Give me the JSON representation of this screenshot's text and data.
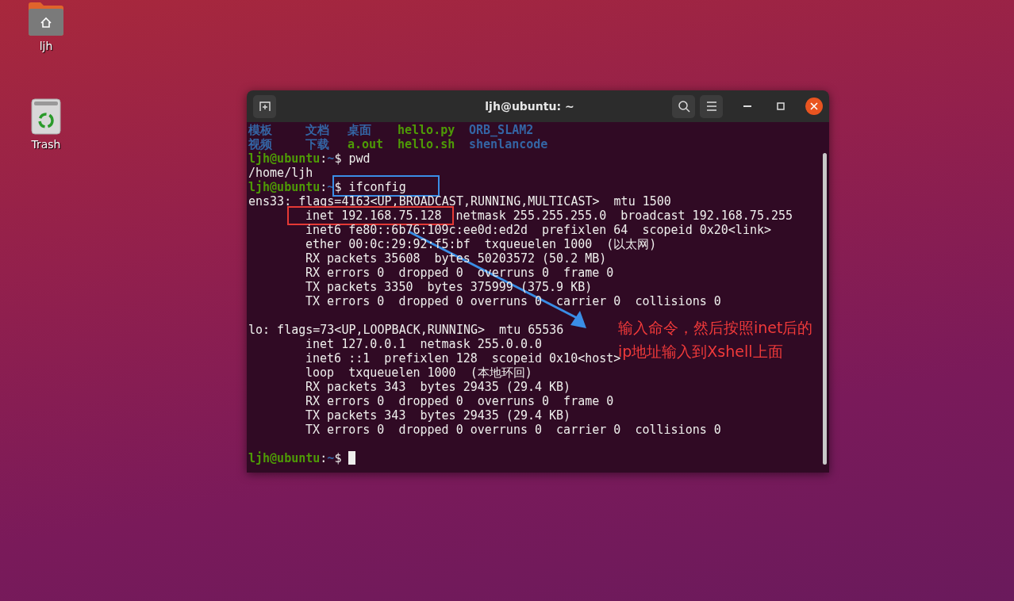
{
  "desktop_icons": [
    {
      "label": "ljh",
      "kind": "home"
    },
    {
      "label": "Trash",
      "kind": "trash"
    }
  ],
  "window": {
    "title": "ljh@ubuntu: ~"
  },
  "terminal": {
    "cursor": true,
    "lines": [
      {
        "kind": "listing",
        "items": [
          {
            "text": "模板",
            "kind": "dir"
          },
          {
            "text": "文档",
            "kind": "dir"
          },
          {
            "text": "桌面",
            "kind": "dir"
          },
          {
            "text": "hello.py",
            "kind": "exec"
          },
          {
            "text": "ORB_SLAM2",
            "kind": "dir"
          }
        ]
      },
      {
        "kind": "listing",
        "items": [
          {
            "text": "视频",
            "kind": "dir"
          },
          {
            "text": "下载",
            "kind": "dir"
          },
          {
            "text": "a.out",
            "kind": "exec"
          },
          {
            "text": "hello.sh",
            "kind": "exec"
          },
          {
            "text": "shenlancode",
            "kind": "dir"
          }
        ]
      },
      {
        "kind": "text",
        "segments": [
          {
            "text": "ljh@ubuntu",
            "kind": "user"
          },
          {
            "text": ":",
            "kind": "plain"
          },
          {
            "text": "~",
            "kind": "path"
          },
          {
            "text": "$ pwd",
            "kind": "plain"
          }
        ]
      },
      {
        "kind": "text",
        "segments": [
          {
            "text": "/home/ljh",
            "kind": "plain"
          }
        ]
      },
      {
        "kind": "text",
        "segments": [
          {
            "text": "ljh@ubuntu",
            "kind": "user"
          },
          {
            "text": ":",
            "kind": "plain"
          },
          {
            "text": "~",
            "kind": "path"
          },
          {
            "text": "$ ifconfig",
            "kind": "plain",
            "color": "#3a8ee6"
          }
        ]
      },
      {
        "kind": "text",
        "segments": [
          {
            "text": "ens33: flags=4163<UP,BROADCAST,RUNNING,MULTICAST>  mtu 1500",
            "kind": "plain"
          }
        ]
      },
      {
        "kind": "detail",
        "segments": [
          {
            "text": "inet 192.168.75.128",
            "kind": "plain",
            "color": "#e53935"
          },
          {
            "text": "netmask 255.255.255.0  broadcast 192.168.75.255",
            "kind": "plain"
          }
        ]
      },
      {
        "kind": "detail",
        "segments": [
          {
            "text": "inet6 fe80::6b76:109c:ee0d:ed2d  prefixlen 64  scopeid 0x20<link>",
            "kind": "plain"
          }
        ]
      },
      {
        "kind": "detail",
        "segments": [
          {
            "text": "ether 00:0c:29:92:f5:bf  txqueuelen 1000  (以太网)",
            "kind": "plain"
          }
        ]
      },
      {
        "kind": "detail",
        "segments": [
          {
            "text": "RX packets 35608  bytes 50203572 (50.2 MB)",
            "kind": "plain"
          }
        ]
      },
      {
        "kind": "detail",
        "segments": [
          {
            "text": "RX errors 0  dropped 0  overruns 0  frame 0",
            "kind": "plain"
          }
        ]
      },
      {
        "kind": "detail",
        "segments": [
          {
            "text": "TX packets 3350  bytes 375999 (375.9 KB)",
            "kind": "plain"
          }
        ]
      },
      {
        "kind": "detail",
        "segments": [
          {
            "text": "TX errors 0  dropped 0 overruns 0  carrier 0  collisions 0",
            "kind": "plain"
          }
        ]
      },
      {
        "kind": "blank"
      },
      {
        "kind": "text",
        "segments": [
          {
            "text": "lo: flags=73<UP,LOOPBACK,RUNNING>  mtu 65536",
            "kind": "plain"
          }
        ]
      },
      {
        "kind": "detail",
        "segments": [
          {
            "text": "inet 127.0.0.1  netmask 255.0.0.0",
            "kind": "plain"
          }
        ]
      },
      {
        "kind": "detail",
        "segments": [
          {
            "text": "inet6 ::1  prefixlen 128  scopeid 0x10<host>",
            "kind": "plain"
          }
        ]
      },
      {
        "kind": "detail",
        "segments": [
          {
            "text": "loop  txqueuelen 1000  (本地环回)",
            "kind": "plain"
          }
        ]
      },
      {
        "kind": "detail",
        "segments": [
          {
            "text": "RX packets 343  bytes 29435 (29.4 KB)",
            "kind": "plain"
          }
        ]
      },
      {
        "kind": "detail",
        "segments": [
          {
            "text": "RX errors 0  dropped 0  overruns 0  frame 0",
            "kind": "plain"
          }
        ]
      },
      {
        "kind": "detail",
        "segments": [
          {
            "text": "TX packets 343  bytes 29435 (29.4 KB)",
            "kind": "plain"
          }
        ]
      },
      {
        "kind": "detail",
        "segments": [
          {
            "text": "TX errors 0  dropped 0 overruns 0  carrier 0  collisions 0",
            "kind": "plain"
          }
        ]
      },
      {
        "kind": "blank"
      },
      {
        "kind": "text",
        "segments": [
          {
            "text": "ljh@ubuntu",
            "kind": "user"
          },
          {
            "text": ":",
            "kind": "plain"
          },
          {
            "text": "~",
            "kind": "path"
          },
          {
            "text": "$",
            "kind": "plain"
          }
        ]
      }
    ]
  },
  "annotation": {
    "note": "输入命令，然后按照inet后的\nip地址输入到Xshell上面"
  }
}
